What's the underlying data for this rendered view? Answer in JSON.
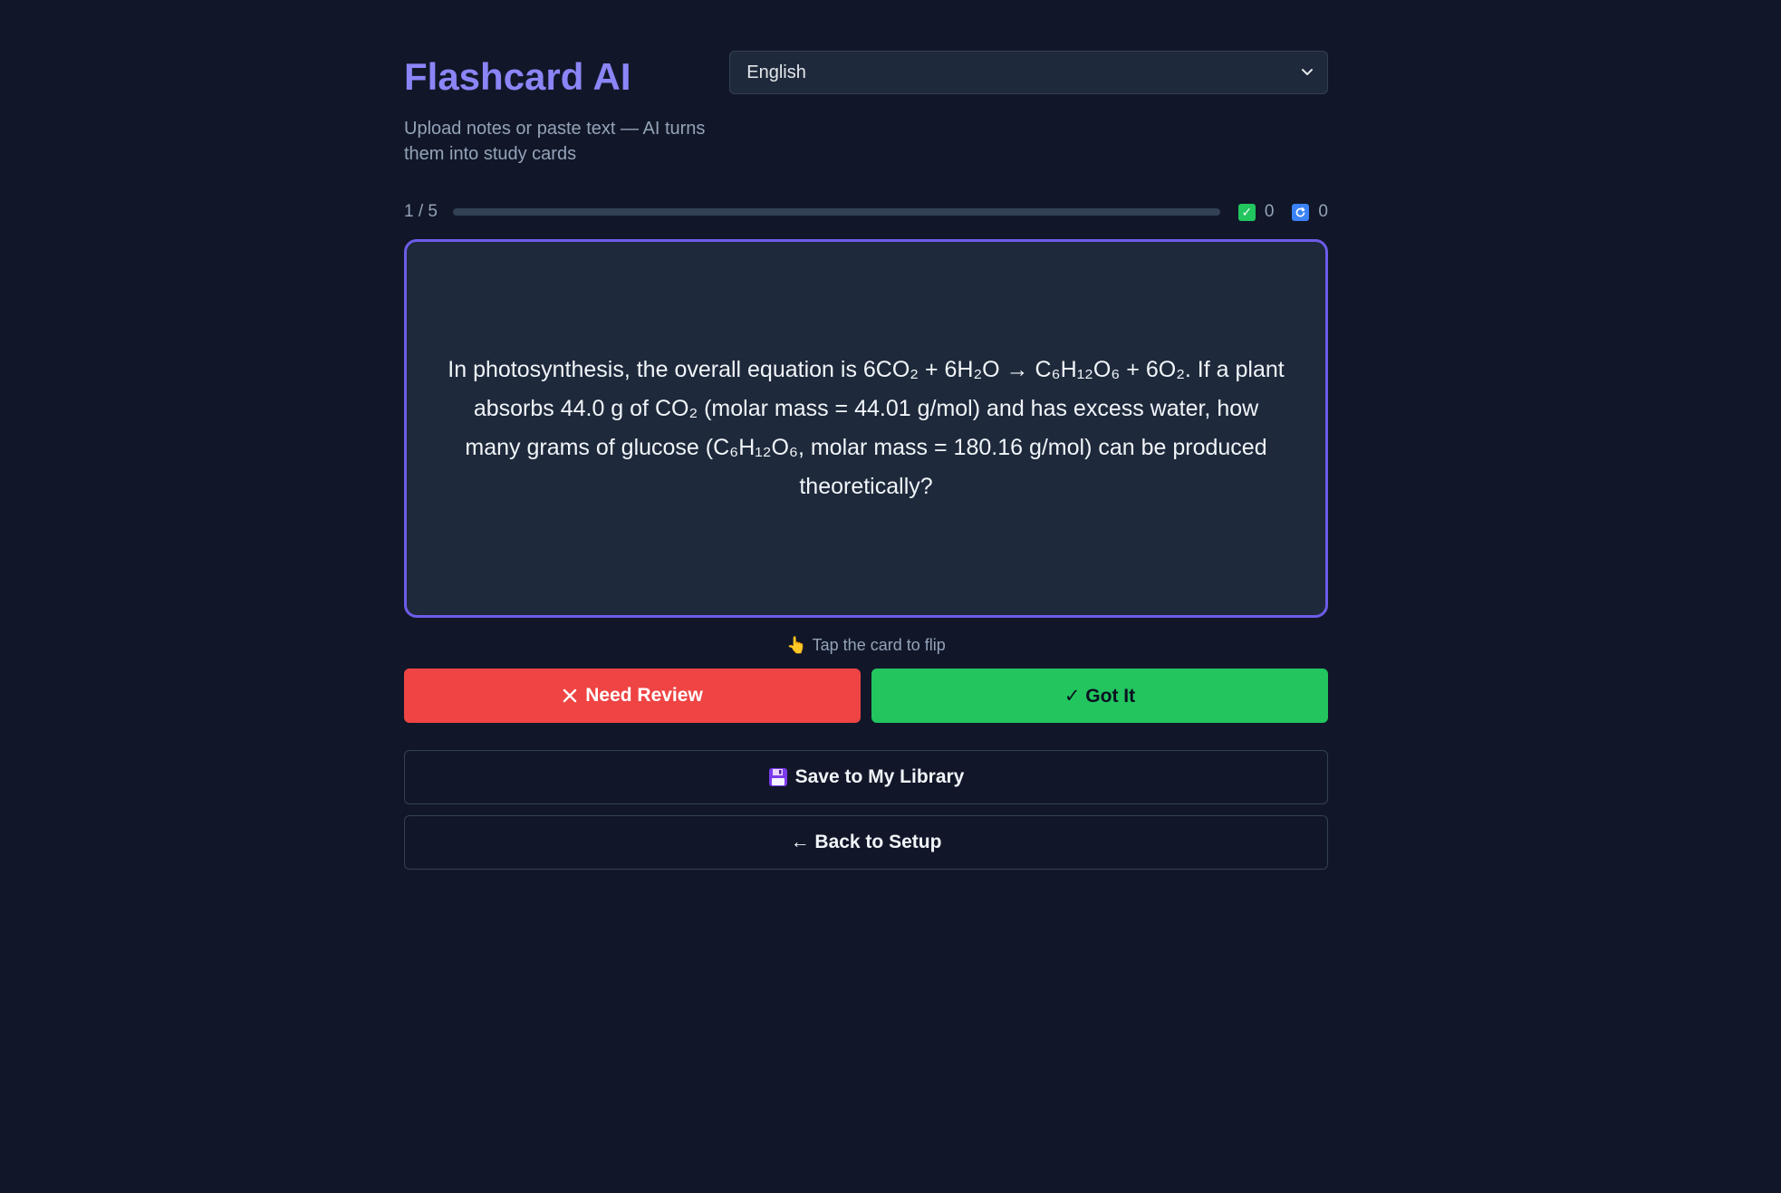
{
  "header": {
    "title": "Flashcard AI",
    "subtitle": "Upload notes or paste text — AI turns them into study cards"
  },
  "language_select": {
    "selected": "English"
  },
  "progress": {
    "counter": "1 / 5",
    "fraction": 0,
    "known_count": "0",
    "review_count": "0"
  },
  "card": {
    "question": "In photosynthesis, the overall equation is 6CO₂ + 6H₂O → C₆H₁₂O₆ + 6O₂. If a plant absorbs 44.0 g of CO₂ (molar mass = 44.01 g/mol) and has excess water, how many grams of glucose (C₆H₁₂O₆, molar mass = 180.16 g/mol) can be produced theoretically?",
    "hint": "Tap the card to flip"
  },
  "actions": {
    "need_review": "Need Review",
    "got_it": "✓ Got It",
    "save": "Save to My Library",
    "back": "← Back to Setup"
  },
  "icons": {
    "known": "check-box-icon",
    "review": "refresh-icon",
    "hint": "pointing-hand-icon",
    "save": "floppy-disk-icon"
  },
  "colors": {
    "accent": "#8b85f7",
    "card_border": "#6d5ce8",
    "review": "#ef4444",
    "got_it": "#22c55e"
  }
}
